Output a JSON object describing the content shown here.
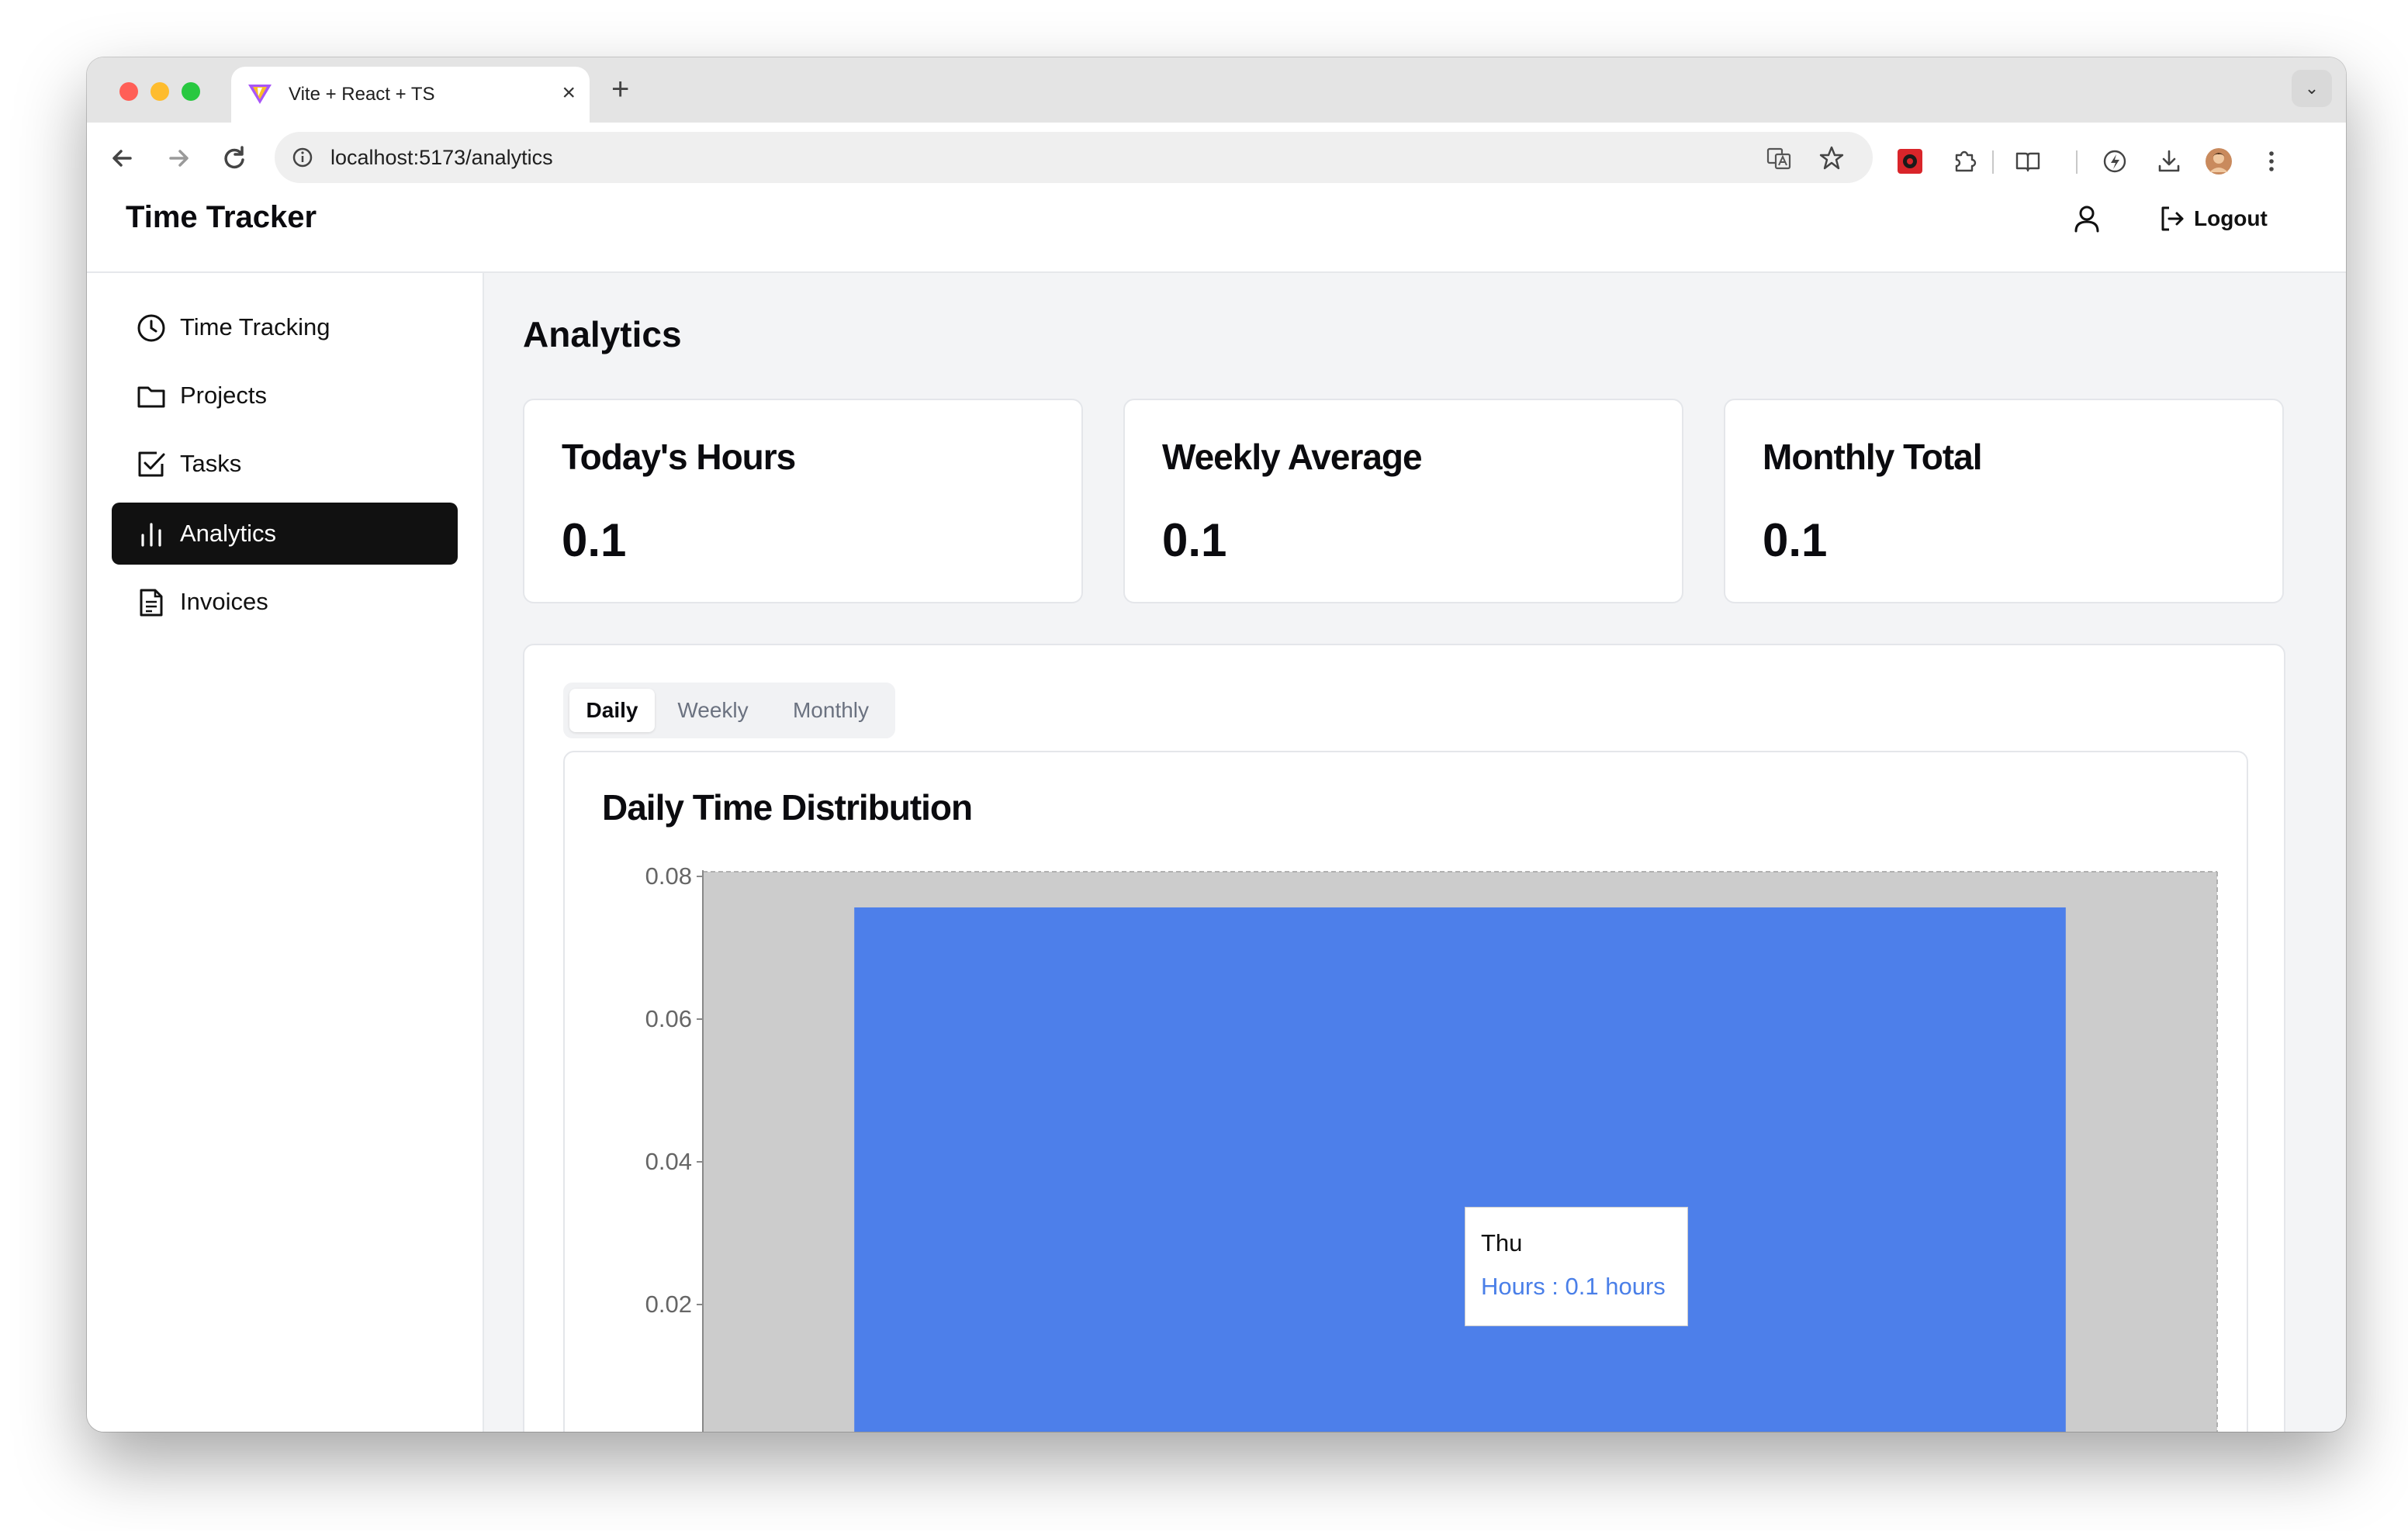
{
  "browser": {
    "tab_title": "Vite + React + TS",
    "tab_close": "×",
    "new_tab": "+",
    "tab_menu": "⌄",
    "url": "localhost:5173/analytics"
  },
  "header": {
    "brand": "Time Tracker",
    "logout_label": "Logout"
  },
  "sidebar": {
    "items": [
      {
        "label": "Time Tracking",
        "icon": "clock-icon"
      },
      {
        "label": "Projects",
        "icon": "folder-icon"
      },
      {
        "label": "Tasks",
        "icon": "checkbox-icon"
      },
      {
        "label": "Analytics",
        "icon": "bar-chart-icon",
        "active": true
      },
      {
        "label": "Invoices",
        "icon": "file-text-icon"
      }
    ]
  },
  "main": {
    "title": "Analytics",
    "stats": [
      {
        "title": "Today's Hours",
        "value": "0.1"
      },
      {
        "title": "Weekly Average",
        "value": "0.1"
      },
      {
        "title": "Monthly Total",
        "value": "0.1"
      }
    ],
    "tabs": [
      {
        "label": "Daily",
        "active": true
      },
      {
        "label": "Weekly"
      },
      {
        "label": "Monthly"
      }
    ]
  },
  "colors": {
    "bar": "#4d7fea",
    "plot_background": "#cccccc",
    "active_nav": "#111111",
    "page_background": "#f3f4f6"
  },
  "chart_data": {
    "type": "bar",
    "title": "Daily Time Distribution",
    "categories": [
      "Thu"
    ],
    "series": [
      {
        "name": "Hours",
        "values": [
          0.1
        ]
      }
    ],
    "yticks": [
      "0.02",
      "0.04",
      "0.06",
      "0.08"
    ],
    "ylim": [
      0,
      0.08
    ],
    "grid": false,
    "legend": "none",
    "tooltip": {
      "label": "Thu",
      "text": "Hours : 0.1 hours"
    }
  }
}
